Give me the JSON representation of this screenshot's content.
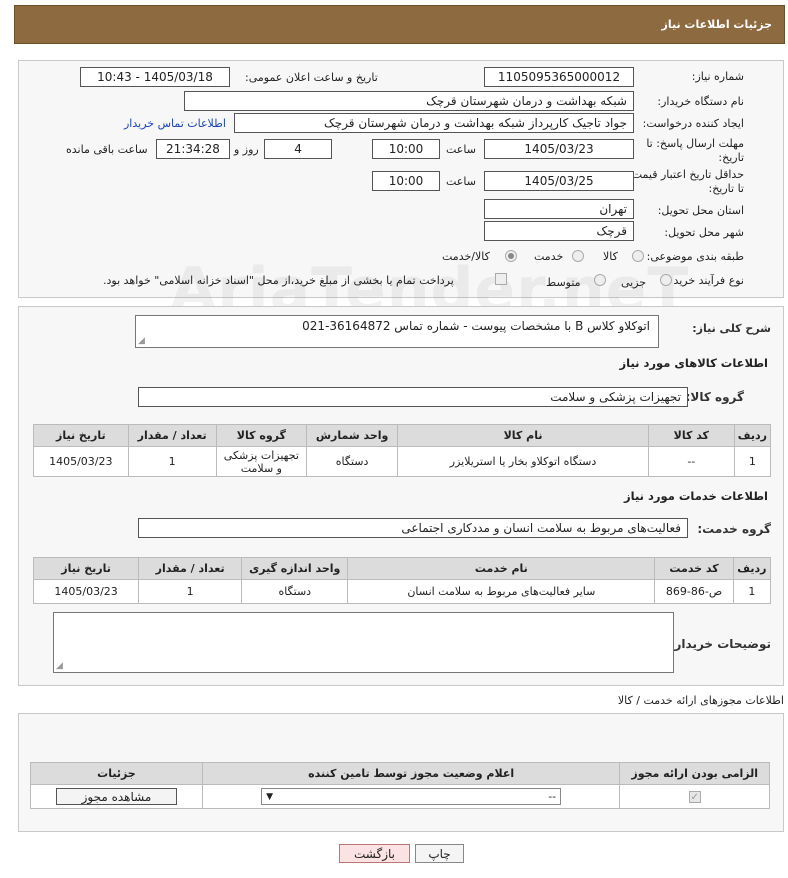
{
  "header": {
    "title": "جزئیات اطلاعات نیاز"
  },
  "form": {
    "need_number_label": "شماره نیاز:",
    "need_number": "1105095365000012",
    "announce_label": "تاریخ و ساعت اعلان عمومی:",
    "announce_value": "1405/03/18 - 10:43",
    "buyer_label": "نام دستگاه خریدار:",
    "buyer_value": "شبکه بهداشت و درمان شهرستان قرچک",
    "creator_label": "ایجاد کننده درخواست:",
    "creator_value": "جواد تاجیک کارپرداز شبکه بهداشت و درمان شهرستان قرچک",
    "contact_link": "اطلاعات تماس خریدار",
    "deadline_label_1": "مهلت ارسال پاسخ: تا",
    "deadline_label_2": "تاریخ:",
    "deadline_date": "1405/03/23",
    "time_label": "ساعت",
    "deadline_time": "10:00",
    "days_value": "4",
    "days_label": "روز و",
    "remaining_time": "21:34:28",
    "remaining_label": "ساعت باقی مانده",
    "validity_label_1": "حداقل تاریخ اعتبار قیمت:",
    "validity_label_2": "تا تاریخ:",
    "validity_date": "1405/03/25",
    "validity_time": "10:00",
    "province_label": "استان محل تحویل:",
    "province_value": "تهران",
    "city_label": "شهر محل تحویل:",
    "city_value": "قرچک",
    "category_label": "طبقه بندی موضوعی:",
    "category_options": [
      "کالا",
      "خدمت",
      "کالا/خدمت"
    ],
    "process_label": "نوع فرآیند خرید :",
    "process_options": [
      "جزیی",
      "متوسط"
    ],
    "payment_note": "پرداخت تمام یا بخشی از مبلغ خرید،از محل \"اسناد خزانه اسلامی\" خواهد بود."
  },
  "description": {
    "label": "شرح کلی نیاز:",
    "value": "اتوکلاو کلاس B با مشخصات پیوست - شماره تماس 36164872-021"
  },
  "goods": {
    "section_title": "اطلاعات کالاهای مورد نیاز",
    "group_label": "گروه کالا:",
    "group_value": "تجهیزات پزشکی و سلامت",
    "columns": [
      "ردیف",
      "کد کالا",
      "نام کالا",
      "واحد شمارش",
      "گروه کالا",
      "تعداد / مقدار",
      "تاریخ نیاز"
    ],
    "rows": [
      [
        "1",
        "--",
        "دستگاه اتوکلاو بخار یا استریلایزر",
        "دستگاه",
        "تجهیزات پزشکی و سلامت",
        "1",
        "1405/03/23"
      ]
    ]
  },
  "services": {
    "section_title": "اطلاعات خدمات مورد نیاز",
    "group_label": "گروه خدمت:",
    "group_value": "فعالیت‌های مربوط به سلامت انسان و مددکاری اجتماعی",
    "columns": [
      "ردیف",
      "کد خدمت",
      "نام خدمت",
      "واحد اندازه گیری",
      "تعداد / مقدار",
      "تاریخ نیاز"
    ],
    "rows": [
      [
        "1",
        "ص-86-869",
        "سایر فعالیت‌های مربوط به سلامت انسان",
        "دستگاه",
        "1",
        "1405/03/23"
      ]
    ]
  },
  "buyer_notes": {
    "label": "توضیحات خریدار:"
  },
  "permits": {
    "section_title": "اطلاعات مجوزهای ارائه خدمت / کالا",
    "columns": [
      "الزامی بودن ارائه مجوز",
      "اعلام وضعیت مجوز توسط تامین کننده",
      "جزئیات"
    ],
    "select_value": "--",
    "view_button": "مشاهده مجوز"
  },
  "footer": {
    "print_button": "چاپ",
    "back_button": "بازگشت"
  },
  "watermark": "AriaTender.neT"
}
